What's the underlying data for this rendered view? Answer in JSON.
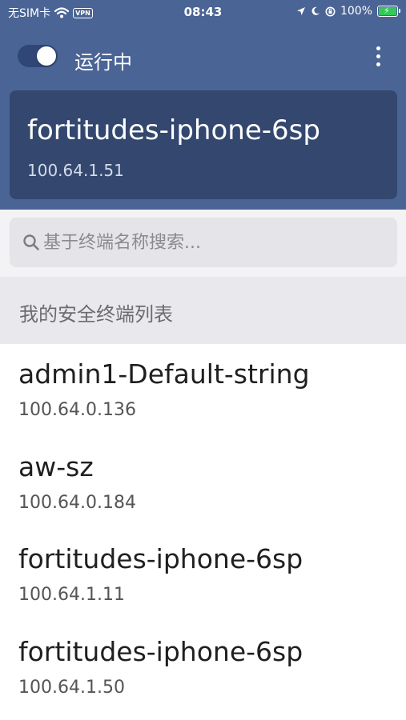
{
  "status_bar": {
    "carrier": "无SIM卡",
    "vpn_badge": "VPN",
    "time": "08:43",
    "battery_percent": "100%",
    "icons": [
      "wifi-icon",
      "location-icon",
      "moon-icon",
      "orientation-lock-icon",
      "battery-charging-icon"
    ]
  },
  "header": {
    "toggle_on": true,
    "status_label": "运行中",
    "more_icon": "more-vertical-icon"
  },
  "current_device": {
    "name": "fortitudes-iphone-6sp",
    "ip": "100.64.1.51"
  },
  "search": {
    "placeholder": "基于终端名称搜索...",
    "icon": "search-icon"
  },
  "section": {
    "title": "我的安全终端列表"
  },
  "devices": [
    {
      "name": "admin1-Default-string",
      "ip": "100.64.0.136"
    },
    {
      "name": "aw-sz",
      "ip": "100.64.0.184"
    },
    {
      "name": "fortitudes-iphone-6sp",
      "ip": "100.64.1.11"
    },
    {
      "name": "fortitudes-iphone-6sp",
      "ip": "100.64.1.50"
    }
  ],
  "colors": {
    "header_bg": "#4a6495",
    "card_bg": "#33476f",
    "toggle_track": "#2f4677",
    "search_band": "#f3f3f5",
    "section_bg": "#e8e8ed"
  }
}
